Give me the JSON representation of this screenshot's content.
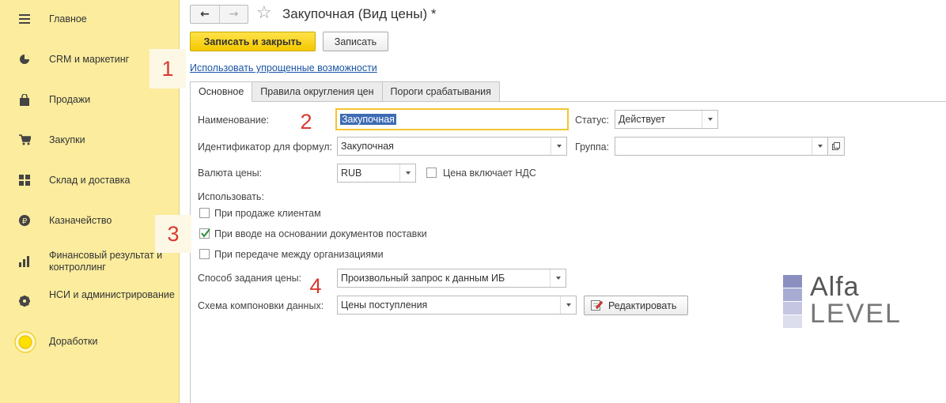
{
  "sidebar": {
    "items": [
      {
        "label": "Главное",
        "icon": "menu-icon"
      },
      {
        "label": "CRM и маркетинг",
        "icon": "pie-chart-icon"
      },
      {
        "label": "Продажи",
        "icon": "shopping-bag-icon"
      },
      {
        "label": "Закупки",
        "icon": "cart-icon"
      },
      {
        "label": "Склад и доставка",
        "icon": "grid-icon"
      },
      {
        "label": "Казначейство",
        "icon": "ruble-icon"
      },
      {
        "label": "Финансовый результат и контроллинг",
        "icon": "bar-chart-icon"
      },
      {
        "label": "НСИ и администрирование",
        "icon": "gear-icon"
      },
      {
        "label": "Доработки",
        "icon": "circle-icon"
      }
    ]
  },
  "header": {
    "title": "Закупочная (Вид цены) *",
    "back_arrow": "←",
    "forward_arrow": "→",
    "star": "☆"
  },
  "toolbar": {
    "save_close_label": "Записать и закрыть",
    "save_label": "Записать"
  },
  "simplified_link": "Использовать упрощенные возможности",
  "tabs": [
    {
      "label": "Основное",
      "active": true
    },
    {
      "label": "Правила округления цен",
      "active": false
    },
    {
      "label": "Пороги срабатывания",
      "active": false
    }
  ],
  "form": {
    "name_label": "Наименование:",
    "name_value": "Закупочная",
    "status_label": "Статус:",
    "status_value": "Действует",
    "formula_id_label": "Идентификатор для формул:",
    "formula_id_value": "Закупочная",
    "group_label": "Группа:",
    "group_value": "",
    "currency_label": "Валюта цены:",
    "currency_value": "RUB",
    "vat_label": "Цена включает НДС",
    "vat_checked": false,
    "use_label": "Использовать:",
    "use_options": [
      {
        "label": "При продаже клиентам",
        "checked": false
      },
      {
        "label": "При вводе на основании документов поставки",
        "checked": true
      },
      {
        "label": "При передаче между организациями",
        "checked": false
      }
    ],
    "method_label": "Способ задания цены:",
    "method_value": "Произвольный запрос к данным ИБ",
    "schema_label": "Схема компоновки данных:",
    "schema_value": "Цены поступления",
    "edit_label": "Редактировать"
  },
  "markers": [
    "1",
    "2",
    "3",
    "4"
  ],
  "logo": {
    "line1": "Alfa",
    "line2": "LEVEL"
  },
  "colors": {
    "sidebar": "#fbec9e",
    "primary": "#f4c900",
    "link": "#1a55a6",
    "marker": "#d9392f"
  }
}
